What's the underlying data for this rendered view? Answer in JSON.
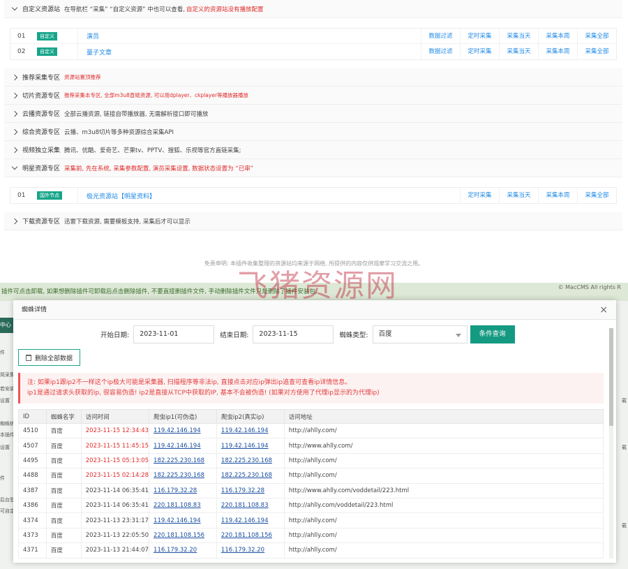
{
  "top": {
    "custom_section": {
      "title": "自定义资源站",
      "desc": "在导航栏 “采集” “自定义资源” 中也可以查看,",
      "note": "自定义的资源站没有播放配置"
    },
    "custom_rows": [
      {
        "idx": "01",
        "tag": "自定义",
        "name": "演员",
        "actions": [
          "数据过滤",
          "定时采集",
          "采集当天",
          "采集本周",
          "采集全部"
        ]
      },
      {
        "idx": "02",
        "tag": "自定义",
        "name": "量子文章",
        "actions": [
          "数据过滤",
          "定时采集",
          "采集当天",
          "采集本周",
          "采集全部"
        ]
      }
    ],
    "sections": [
      {
        "title": "推荐采集专区",
        "note": "资源站置顶推荐",
        "red": true
      },
      {
        "title": "切片资源专区",
        "note": "推荐采集本专区, 全部m3u8直链资源, 可以用dplayer、ckplayer等播放器播放",
        "red": true
      },
      {
        "title": "云播资源专区",
        "note": "全部云播资源, 链接自带播放器, 无需解析接口即可播放",
        "red": false
      },
      {
        "title": "综合资源专区",
        "note": "云播、m3u8切片等多种资源综合采集API",
        "red": false
      },
      {
        "title": "视频独立采集",
        "note": "腾讯、优酷、爱奇艺、芒果tv、PPTV、搜狐、乐视等官方直链采集;",
        "red": false
      }
    ],
    "star_section": {
      "title": "明星资源专区",
      "note": "采集前, 先在系统, 采集参数配置, 演员采集设置, 数据状态设置为 “已审”"
    },
    "star_rows": [
      {
        "idx": "01",
        "tag": "国外节点",
        "name": "极光资源站【明星资料】",
        "actions": [
          "定时采集",
          "采集当天",
          "采集本周",
          "采集全部"
        ]
      }
    ],
    "download_section": {
      "title": "下载资源专区",
      "note": "迅雷下载资源, 需要模板支持, 采集后才可以显示"
    },
    "disclaimer": "免责申明: 本插件收集整理的资源站均来源于网络, 所提供的内容仅供观摩学习交流之用。",
    "watermark": "飞猪资源网"
  },
  "bg": {
    "notice": "插件可点击卸载, 如果想删除插件可卸载后点击删除插件, 不要直接删插件文件, 手动删除插件文件只是删除了插件安装包。",
    "right_top": "© MacCMS All rights R",
    "left_block": "中心",
    "left_labels": [
      "件",
      "简采集",
      "若安装",
      "设置",
      "蜘蛛统",
      "本插件",
      "设置",
      "件",
      "后台登",
      "可自定"
    ],
    "right_labels": [
      "载",
      "载",
      "载"
    ]
  },
  "modal": {
    "title": "蜘蛛详情",
    "close": "×",
    "start_label": "开始日期:",
    "start_value": "2023-11-01",
    "end_label": "结束日期:",
    "end_value": "2023-11-15",
    "type_label": "蜘蛛类型:",
    "type_value": "百度",
    "query_btn": "条件查询",
    "delete_btn": "删除全部数据",
    "alert_line1": "注: 如果ip1跟ip2不一样这个ip极大可能是采集器, 扫描程序等非法ip, 直接点击对应ip弹出ip追查可查看ip详情信息。",
    "alert_line2": "ip1是通过请求头获取的ip, 很容易伪造! ip2是直接从TCP中获取的IP, 基本不会被伪造! (如果对方使用了代理ip显示的为代理ip)",
    "headers": [
      "ID",
      "蜘蛛名字",
      "访问时间",
      "爬虫ip1(可伪造)",
      "爬虫ip2(真实ip)",
      "访问地址"
    ],
    "rows": [
      {
        "id": "4510",
        "name": "百度",
        "time": "2023-11-15 12:34:43",
        "ip1": "119.42.146.194",
        "ip2": "119.42.146.194",
        "url": "http://ahlly.com/",
        "red": true
      },
      {
        "id": "4507",
        "name": "百度",
        "time": "2023-11-15 11:45:15",
        "ip1": "119.42.146.194",
        "ip2": "119.42.146.194",
        "url": "http://www.ahlly.com/",
        "red": true
      },
      {
        "id": "4495",
        "name": "百度",
        "time": "2023-11-15 05:13:05",
        "ip1": "182.225.230.168",
        "ip2": "182.225.230.168",
        "url": "http://ahlly.com/",
        "red": true
      },
      {
        "id": "4488",
        "name": "百度",
        "time": "2023-11-15 02:14:28",
        "ip1": "182.225.230.168",
        "ip2": "182.225.230.168",
        "url": "http://ahlly.com/",
        "red": true
      },
      {
        "id": "4387",
        "name": "百度",
        "time": "2023-11-14 06:35:41",
        "ip1": "116.179.32.28",
        "ip2": "116.179.32.28",
        "url": "http://www.ahlly.com/voddetail/223.html",
        "red": false
      },
      {
        "id": "4386",
        "name": "百度",
        "time": "2023-11-14 06:35:41",
        "ip1": "220.181.108.83",
        "ip2": "220.181.108.83",
        "url": "http://ahlly.com/voddetail/223.html",
        "red": false
      },
      {
        "id": "4374",
        "name": "百度",
        "time": "2023-11-13 23:31:17",
        "ip1": "119.42.146.194",
        "ip2": "119.42.146.194",
        "url": "http://ahlly.com/",
        "red": false
      },
      {
        "id": "4373",
        "name": "百度",
        "time": "2023-11-13 22:05:50",
        "ip1": "220.181.108.156",
        "ip2": "220.181.108.156",
        "url": "http://ahlly.com/",
        "red": false
      },
      {
        "id": "4371",
        "name": "百度",
        "time": "2023-11-13 21:44:07",
        "ip1": "116.179.32.20",
        "ip2": "116.179.32.20",
        "url": "http://ahlly.com/",
        "red": false
      }
    ]
  }
}
